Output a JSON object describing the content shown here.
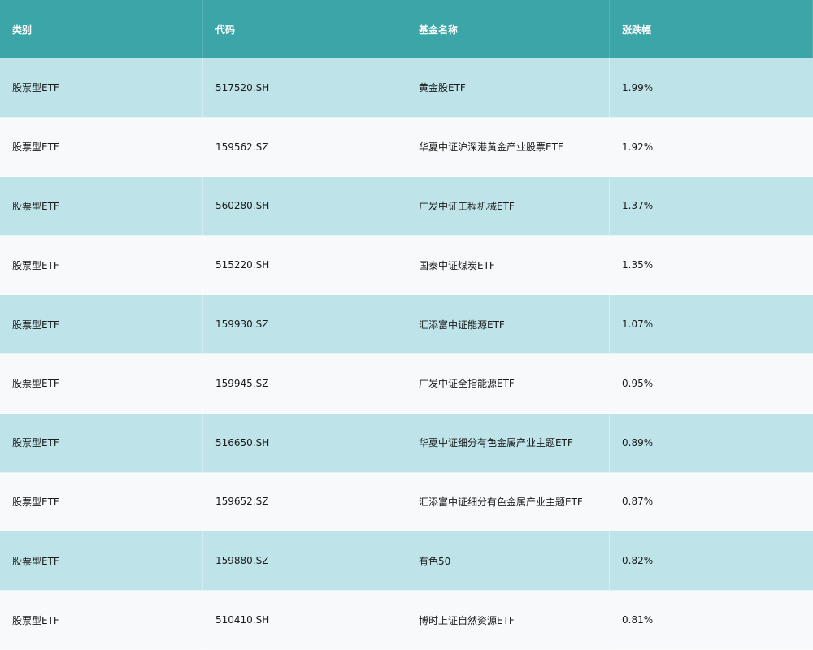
{
  "table": {
    "headers": [
      "类别",
      "代码",
      "基金名称",
      "涨跌幅"
    ],
    "rows": [
      {
        "category": "股票型ETF",
        "code": "517520.SH",
        "name": "黄金股ETF",
        "change": "1.99%"
      },
      {
        "category": "股票型ETF",
        "code": "159562.SZ",
        "name": "华夏中证沪深港黄金产业股票ETF",
        "change": "1.92%"
      },
      {
        "category": "股票型ETF",
        "code": "560280.SH",
        "name": "广发中证工程机械ETF",
        "change": "1.37%"
      },
      {
        "category": "股票型ETF",
        "code": "515220.SH",
        "name": "国泰中证煤炭ETF",
        "change": "1.35%"
      },
      {
        "category": "股票型ETF",
        "code": "159930.SZ",
        "name": "汇添富中证能源ETF",
        "change": "1.07%"
      },
      {
        "category": "股票型ETF",
        "code": "159945.SZ",
        "name": "广发中证全指能源ETF",
        "change": "0.95%"
      },
      {
        "category": "股票型ETF",
        "code": "516650.SH",
        "name": "华夏中证细分有色金属产业主题ETF",
        "change": "0.89%"
      },
      {
        "category": "股票型ETF",
        "code": "159652.SZ",
        "name": "汇添富中证细分有色金属产业主题ETF",
        "change": "0.87%"
      },
      {
        "category": "股票型ETF",
        "code": "159880.SZ",
        "name": "有色50",
        "change": "0.82%"
      },
      {
        "category": "股票型ETF",
        "code": "510410.SH",
        "name": "博时上证自然资源ETF",
        "change": "0.81%"
      }
    ]
  },
  "colors": {
    "header_bg": "#3ba5a7",
    "row_odd_bg": "#bee4ea",
    "row_even_bg": "#f7f9fb",
    "header_text": "#ffffff",
    "body_text": "#1a1a1a"
  }
}
